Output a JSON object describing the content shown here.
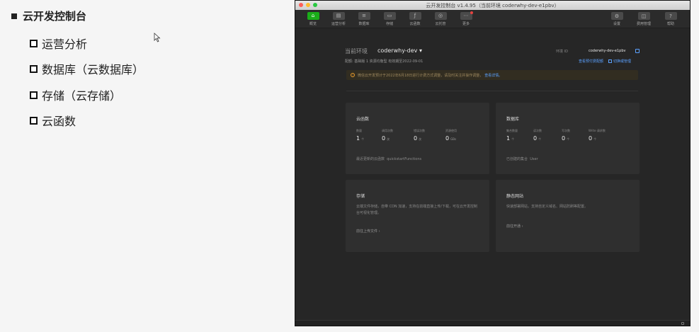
{
  "slide": {
    "title": "云开发控制台",
    "items": [
      "运营分析",
      "数据库（云数据库）",
      "存储（云存储）",
      "云函数"
    ]
  },
  "window": {
    "title": "云开发控制台 v1.4.95（当前环境 coderwhy-dev-e1pbv）",
    "toolbar": {
      "left": [
        {
          "label": "概览",
          "icon": "home-icon",
          "active": true
        },
        {
          "label": "运营分析",
          "icon": "chart-icon"
        },
        {
          "label": "数据库",
          "icon": "database-icon"
        },
        {
          "label": "存储",
          "icon": "storage-icon"
        },
        {
          "label": "云函数",
          "icon": "function-icon"
        },
        {
          "label": "云托管",
          "icon": "hosting-icon"
        },
        {
          "label": "更多",
          "icon": "more-icon",
          "badge": true
        }
      ],
      "right": [
        {
          "label": "设置",
          "icon": "gear-icon"
        },
        {
          "label": "费用管理",
          "icon": "billing-icon"
        },
        {
          "label": "帮助",
          "icon": "help-icon"
        }
      ]
    }
  },
  "env": {
    "label": "当前环境",
    "name": "coderwhy-dev",
    "id_label": "环境 ID",
    "id": "coderwhy-dev-e1pbv"
  },
  "plan": {
    "text": "配额: 基础版 1 资源均衡型 有效期至2022-09-01",
    "link_quota": "查看预付费配额",
    "link_switch": "切换或管理"
  },
  "notice": {
    "text": "微信云开发预计于2022年6月18日进行计费方式调整，请及时关注并操作调整，",
    "link": "查看详情。"
  },
  "cards": {
    "functions": {
      "title": "云函数",
      "metrics": [
        {
          "label": "数量",
          "value": "1",
          "unit": "个"
        },
        {
          "label": "调用次数",
          "value": "0",
          "unit": "次"
        },
        {
          "label": "错误次数",
          "value": "0",
          "unit": "次"
        },
        {
          "label": "资源使用",
          "value": "0",
          "unit": "GBs"
        }
      ],
      "footer_label": "最近更新的云函数",
      "footer_value": "quickstartFunctions"
    },
    "database": {
      "title": "数据库",
      "metrics": [
        {
          "label": "集合数量",
          "value": "1",
          "unit": "个"
        },
        {
          "label": "读次数",
          "value": "0",
          "unit": "个"
        },
        {
          "label": "写次数",
          "value": "0",
          "unit": "个"
        },
        {
          "label": "Write 请求数",
          "value": "0",
          "unit": "个"
        }
      ],
      "footer_label": "已创建的集合",
      "footer_value": "User"
    },
    "storage": {
      "title": "存储",
      "desc": "云端文件存储，自带 CDN 加速，支持在前端直接上传/下载，可在云开发控制台可视化管理。",
      "link": "前往上传文件 ›"
    },
    "website": {
      "title": "静态网站",
      "desc": "快速部署网站，支持自定义域名、网站防刷等配置。",
      "link": "前往开通 ›"
    }
  },
  "colors": {
    "accent_green": "#1aad19",
    "link_blue": "#5ba1ff",
    "warning_orange": "#e89b2c"
  }
}
